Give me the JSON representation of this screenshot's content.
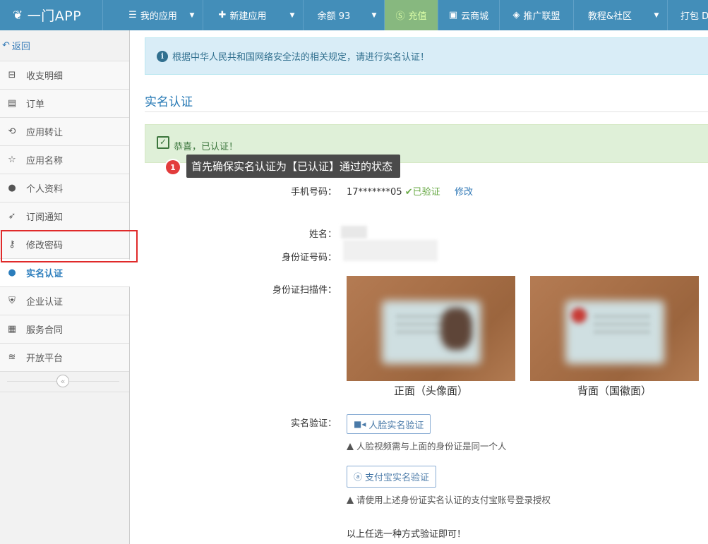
{
  "topbar": {
    "brand": "一门APP",
    "items": [
      {
        "label": "我的应用",
        "icon": "list-icon"
      },
      {
        "label": "新建应用",
        "icon": "plus-icon"
      },
      {
        "label": "余额 93",
        "icon": ""
      },
      {
        "label": "充值",
        "icon": "yen-circle-icon"
      },
      {
        "label": "云商城",
        "icon": "shop-icon"
      },
      {
        "label": "推广联盟",
        "icon": "diamond-icon"
      },
      {
        "label": "教程&社区",
        "icon": ""
      },
      {
        "label": "打包 D",
        "icon": ""
      }
    ]
  },
  "sidebar": {
    "back": "返回",
    "items": [
      {
        "label": "收支明细",
        "icon": "ledger-icon"
      },
      {
        "label": "订单",
        "icon": "order-icon"
      },
      {
        "label": "应用转让",
        "icon": "transfer-icon"
      },
      {
        "label": "应用名称",
        "icon": "star-doc-icon"
      },
      {
        "label": "个人资料",
        "icon": "user-icon"
      },
      {
        "label": "订阅通知",
        "icon": "paper-plane-icon"
      },
      {
        "label": "修改密码",
        "icon": "key-icon"
      },
      {
        "label": "实名认证",
        "icon": "user-check-icon"
      },
      {
        "label": "企业认证",
        "icon": "shield-icon"
      },
      {
        "label": "服务合同",
        "icon": "contract-icon"
      },
      {
        "label": "开放平台",
        "icon": "layers-icon"
      }
    ]
  },
  "main": {
    "notice": "根据中华人民共和国网络安全法的相关规定，请进行实名认证！",
    "section_title": "实名认证",
    "success": "恭喜，已认证！",
    "tooltip": {
      "number": "1",
      "text": "首先确保实名认证为【已认证】通过的状态"
    },
    "phone": {
      "label": "手机号码：",
      "value": "17*******05",
      "status": "已验证",
      "edit": "修改"
    },
    "name_label": "姓名：",
    "idnum_label": "身份证号码：",
    "scan_label": "身份证扫描件：",
    "front_caption": "正面（头像面）",
    "back_caption": "背面（国徽面）",
    "verify_label": "实名验证：",
    "face_button": "人脸实名验证",
    "face_note": "人脸视频需与上面的身份证是同一个人",
    "alipay_button": "支付宝实名验证",
    "alipay_note": "请使用上述身份证实名认证的支付宝账号登录授权",
    "footer_note": "以上任选一种方式验证即可！"
  },
  "colors": {
    "topbar": "#438eb9",
    "accent": "#2b7dbc",
    "highlight": "#e02a2a",
    "recharge": "#87b87f"
  }
}
